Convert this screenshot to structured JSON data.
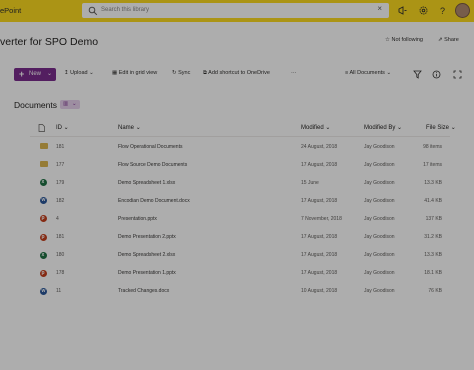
{
  "topbar": {
    "brand": "ePoint",
    "search_placeholder": "Search this library",
    "search_clear": "×"
  },
  "site": {
    "title": "verter for SPO Demo",
    "follow_label": "Not following",
    "share_label": "Share"
  },
  "commands": {
    "new": "New",
    "upload": "Upload",
    "edit_grid": "Edit in grid view",
    "sync": "Sync",
    "add_shortcut": "Add shortcut to OneDrive",
    "more": "···",
    "view": "All Documents"
  },
  "library": {
    "title": "Documents"
  },
  "columns": {
    "id": "ID",
    "name": "Name",
    "modified": "Modified",
    "modified_by": "Modified By",
    "file_size": "File Size"
  },
  "rows": [
    {
      "type": "folder",
      "id": "181",
      "name": "Flow Operational Documents",
      "modified": "24 August, 2018",
      "modified_by": "Jay Goodison",
      "size": "98 items"
    },
    {
      "type": "folder",
      "id": "177",
      "name": "Flow Source Demo Documents",
      "modified": "17 August, 2018",
      "modified_by": "Jay Goodison",
      "size": "17 items"
    },
    {
      "type": "xlsx",
      "id": "179",
      "name": "Demo Spreadsheet 1.xlsx",
      "modified": "15 June",
      "modified_by": "Jay Goodison",
      "size": "13.3 KB"
    },
    {
      "type": "docx",
      "id": "182",
      "name": "Encodian Demo Document.docx",
      "modified": "17 August, 2018",
      "modified_by": "Jay Goodison",
      "size": "41.4 KB"
    },
    {
      "type": "pptx",
      "id": "4",
      "name": "Presentation.pptx",
      "modified": "7 November, 2018",
      "modified_by": "Jay Goodison",
      "size": "137 KB"
    },
    {
      "type": "pptx",
      "id": "181",
      "name": "Demo Presentation 2.pptx",
      "modified": "17 August, 2018",
      "modified_by": "Jay Goodison",
      "size": "31.2 KB"
    },
    {
      "type": "xlsx",
      "id": "180",
      "name": "Demo Spreadsheet 2.xlsx",
      "modified": "17 August, 2018",
      "modified_by": "Jay Goodison",
      "size": "13.3 KB"
    },
    {
      "type": "pptx",
      "id": "178",
      "name": "Demo Presentation 1.pptx",
      "modified": "17 August, 2018",
      "modified_by": "Jay Goodison",
      "size": "18.1 KB"
    },
    {
      "type": "docx",
      "id": "11",
      "name": "Tracked Changes.docx",
      "modified": "10 August, 2018",
      "modified_by": "Jay Goodison",
      "size": "76 KB"
    }
  ],
  "icons": {
    "search": "search-icon",
    "megaphone": "megaphone-icon",
    "settings": "gear-icon",
    "help": "help-icon",
    "filter": "filter-icon",
    "info": "info-icon",
    "expand": "expand-icon"
  },
  "colors": {
    "suite_bar": "#fcdb20",
    "accent": "#7b2d8e",
    "folder": "#dcb64e",
    "excel": "#1f7244",
    "word": "#2b579a",
    "powerpoint": "#c43e1c"
  }
}
